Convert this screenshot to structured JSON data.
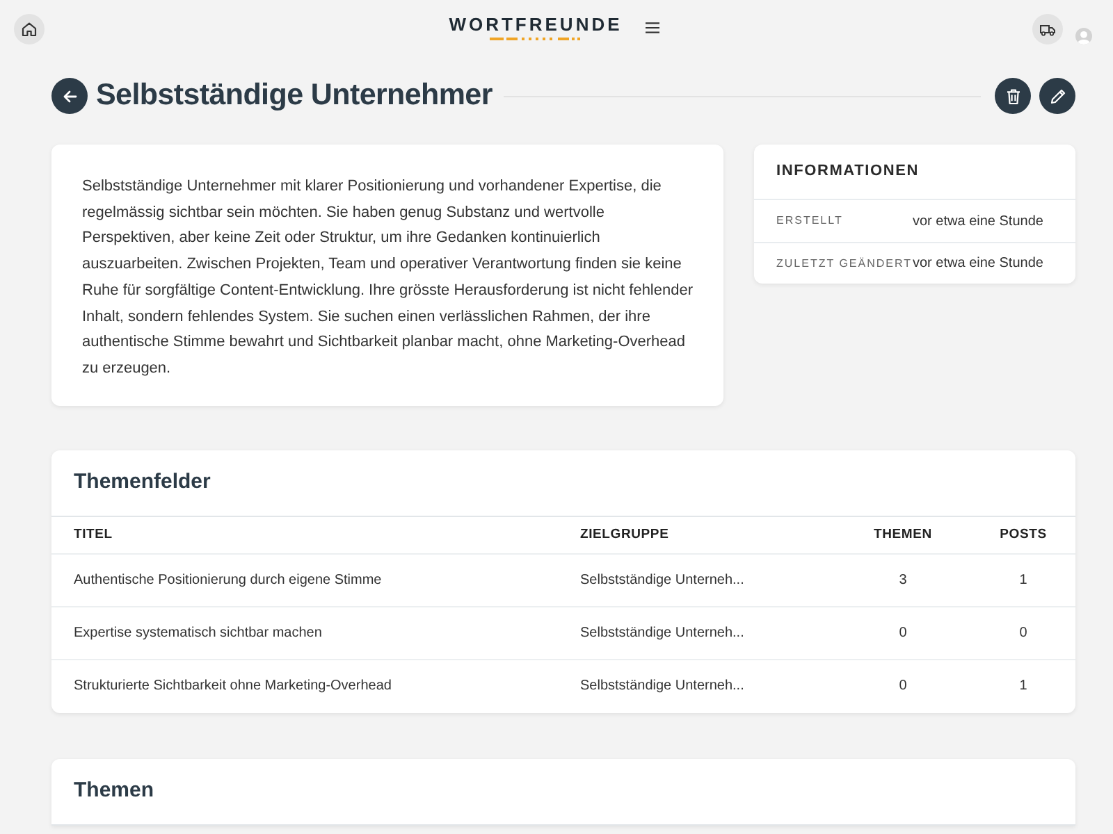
{
  "top_bar": {
    "logo": "WORTFREUNDE"
  },
  "header": {
    "title": "Selbstständige Unternehmer"
  },
  "description": "Selbstständige Unternehmer mit klarer Positionierung und vorhandener Expertise, die regelmässig sichtbar sein möchten. Sie haben genug Substanz und wertvolle Perspektiven, aber keine Zeit oder Struktur, um ihre Gedanken kontinuierlich auszuarbeiten. Zwischen Projekten, Team und operativer Verantwortung finden sie keine Ruhe für sorgfältige Content-Entwicklung. Ihre grösste Herausforderung ist nicht fehlender Inhalt, sondern fehlendes System. Sie suchen einen verlässlichen Rahmen, der ihre authentische Stimme bewahrt und Sichtbarkeit planbar macht, ohne Marketing-Overhead zu erzeugen.",
  "info": {
    "title": "INFORMATIONEN",
    "rows": [
      {
        "label": "ERSTELLT",
        "value": "vor etwa eine Stunde"
      },
      {
        "label": "ZULETZT GEÄNDERT",
        "value": "vor etwa eine Stunde"
      }
    ]
  },
  "themenfelder": {
    "title": "Themenfelder",
    "columns": [
      "TITEL",
      "ZIELGRUPPE",
      "THEMEN",
      "POSTS"
    ],
    "rows": [
      [
        "Authentische Positionierung durch eigene Stimme",
        "Selbstständige Unterneh...",
        "3",
        "1"
      ],
      [
        "Expertise systematisch sichtbar machen",
        "Selbstständige Unterneh...",
        "0",
        "0"
      ],
      [
        "Strukturierte Sichtbarkeit ohne Marketing-Overhead",
        "Selbstständige Unterneh...",
        "0",
        "1"
      ]
    ]
  },
  "themen": {
    "title": "Themen"
  }
}
